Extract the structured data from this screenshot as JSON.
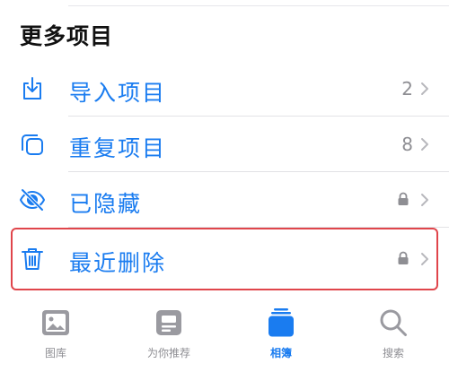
{
  "section": {
    "title": "更多项目"
  },
  "rows": [
    {
      "label": "导入项目",
      "count": "2",
      "icon": "import-icon"
    },
    {
      "label": "重复项目",
      "count": "8",
      "icon": "duplicate-icon"
    },
    {
      "label": "已隐藏",
      "count": "",
      "icon": "hidden-eye-icon",
      "locked": true
    },
    {
      "label": "最近删除",
      "count": "",
      "icon": "trash-icon",
      "locked": true
    }
  ],
  "tabs": [
    {
      "label": "图库",
      "icon": "library-icon"
    },
    {
      "label": "为你推荐",
      "icon": "for-you-icon"
    },
    {
      "label": "相簿",
      "icon": "albums-icon",
      "active": true
    },
    {
      "label": "搜索",
      "icon": "search-icon"
    }
  ],
  "colors": {
    "accent": "#1a7cf0",
    "highlight_border": "#e0454b",
    "secondary_text": "#8e8e93"
  }
}
